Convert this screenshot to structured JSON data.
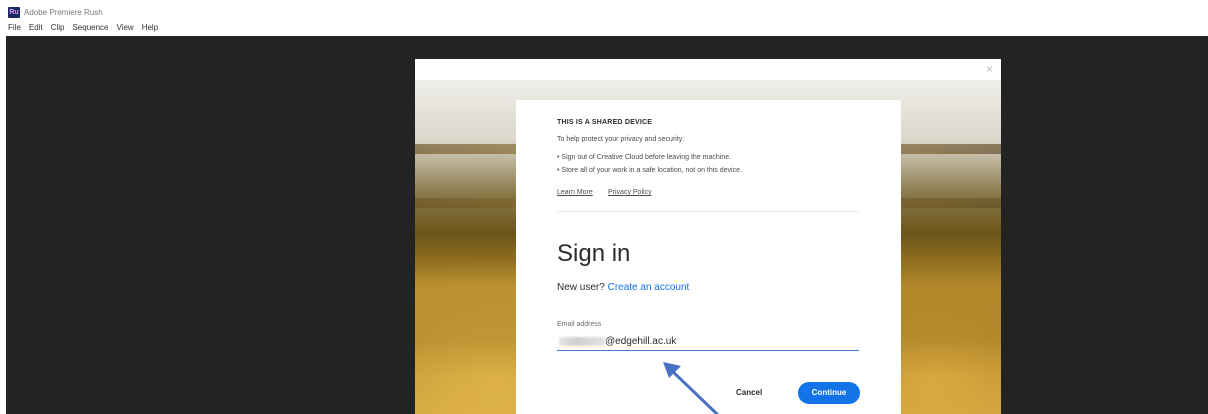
{
  "titlebar": {
    "title": "Adobe Premiere Rush",
    "logo_text": "Ru"
  },
  "menubar": {
    "items": [
      "File",
      "Edit",
      "Clip",
      "Sequence",
      "View",
      "Help"
    ]
  },
  "window": {
    "close_glyph": "×"
  },
  "dialog": {
    "notice_heading": "THIS IS A SHARED DEVICE",
    "notice_intro": "To help protect your privacy and security:",
    "bullets": [
      "• Sign out of Creative Cloud before leaving the machine.",
      "• Store all of your work in a safe location, not on this device."
    ],
    "learn_more": "Learn More",
    "privacy_policy": "Privacy Policy",
    "title": "Sign in",
    "new_user_prompt": "New user?",
    "create_account": "Create an account",
    "email_label": "Email address",
    "email_domain": "@edgehill.ac.uk",
    "cancel_label": "Cancel",
    "continue_label": "Continue"
  },
  "colors": {
    "accent_blue": "#1473e6",
    "workspace": "#232323",
    "annotation_arrow": "#4a72c4"
  },
  "icons": {
    "app_logo": "premiere-rush-logo-icon",
    "close": "close-icon",
    "arrow": "annotation-arrow-icon"
  }
}
